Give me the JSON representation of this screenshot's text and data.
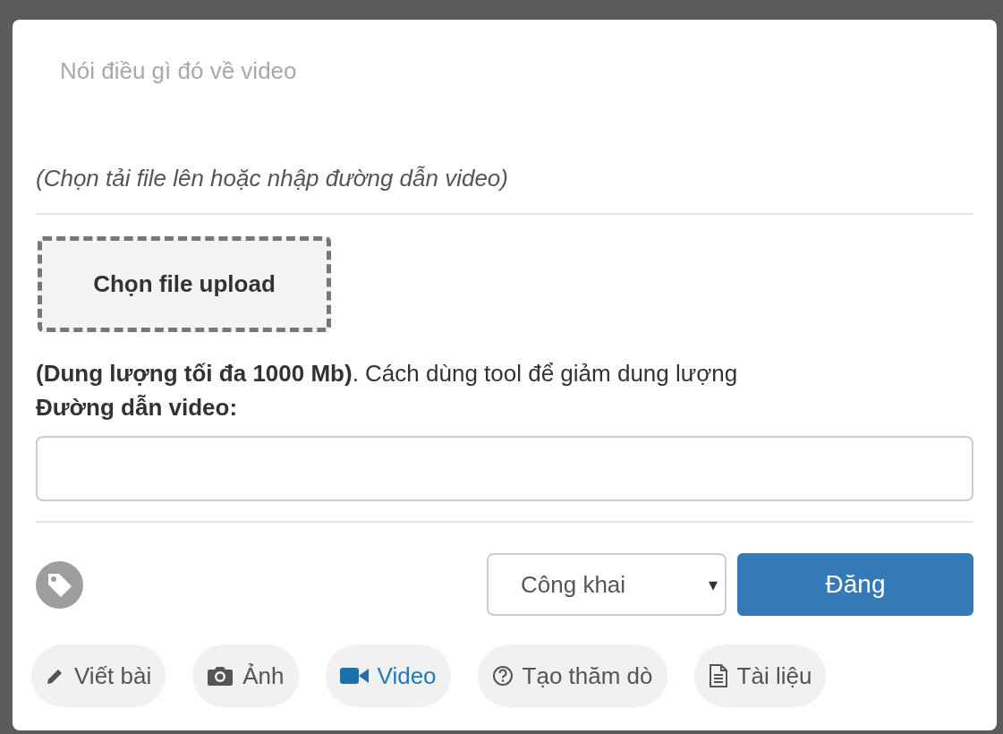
{
  "composer": {
    "placeholder": "Nói điều gì đó về video"
  },
  "hint": "(Chọn tải file lên hoặc nhập đường dẫn video)",
  "upload_button": "Chọn file upload",
  "size_note": "**(Dung lượng tối đa 1000 Mb)**. Cách dùng tool để giảm dung lượng",
  "url_label": "Đường dẫn video:",
  "privacy_select": {
    "value": "Công khai",
    "caret": "▾"
  },
  "submit_button": "Đăng",
  "post_types": [
    {
      "kind": "pencil",
      "label": "Viết bài",
      "selected": false
    },
    {
      "kind": "camera",
      "label": "Ảnh",
      "selected": false
    },
    {
      "kind": "video",
      "label": "Video",
      "selected": true
    },
    {
      "kind": "question",
      "label": "Tạo thăm dò",
      "selected": false
    },
    {
      "kind": "document",
      "label": "Tài liệu",
      "selected": false
    }
  ]
}
